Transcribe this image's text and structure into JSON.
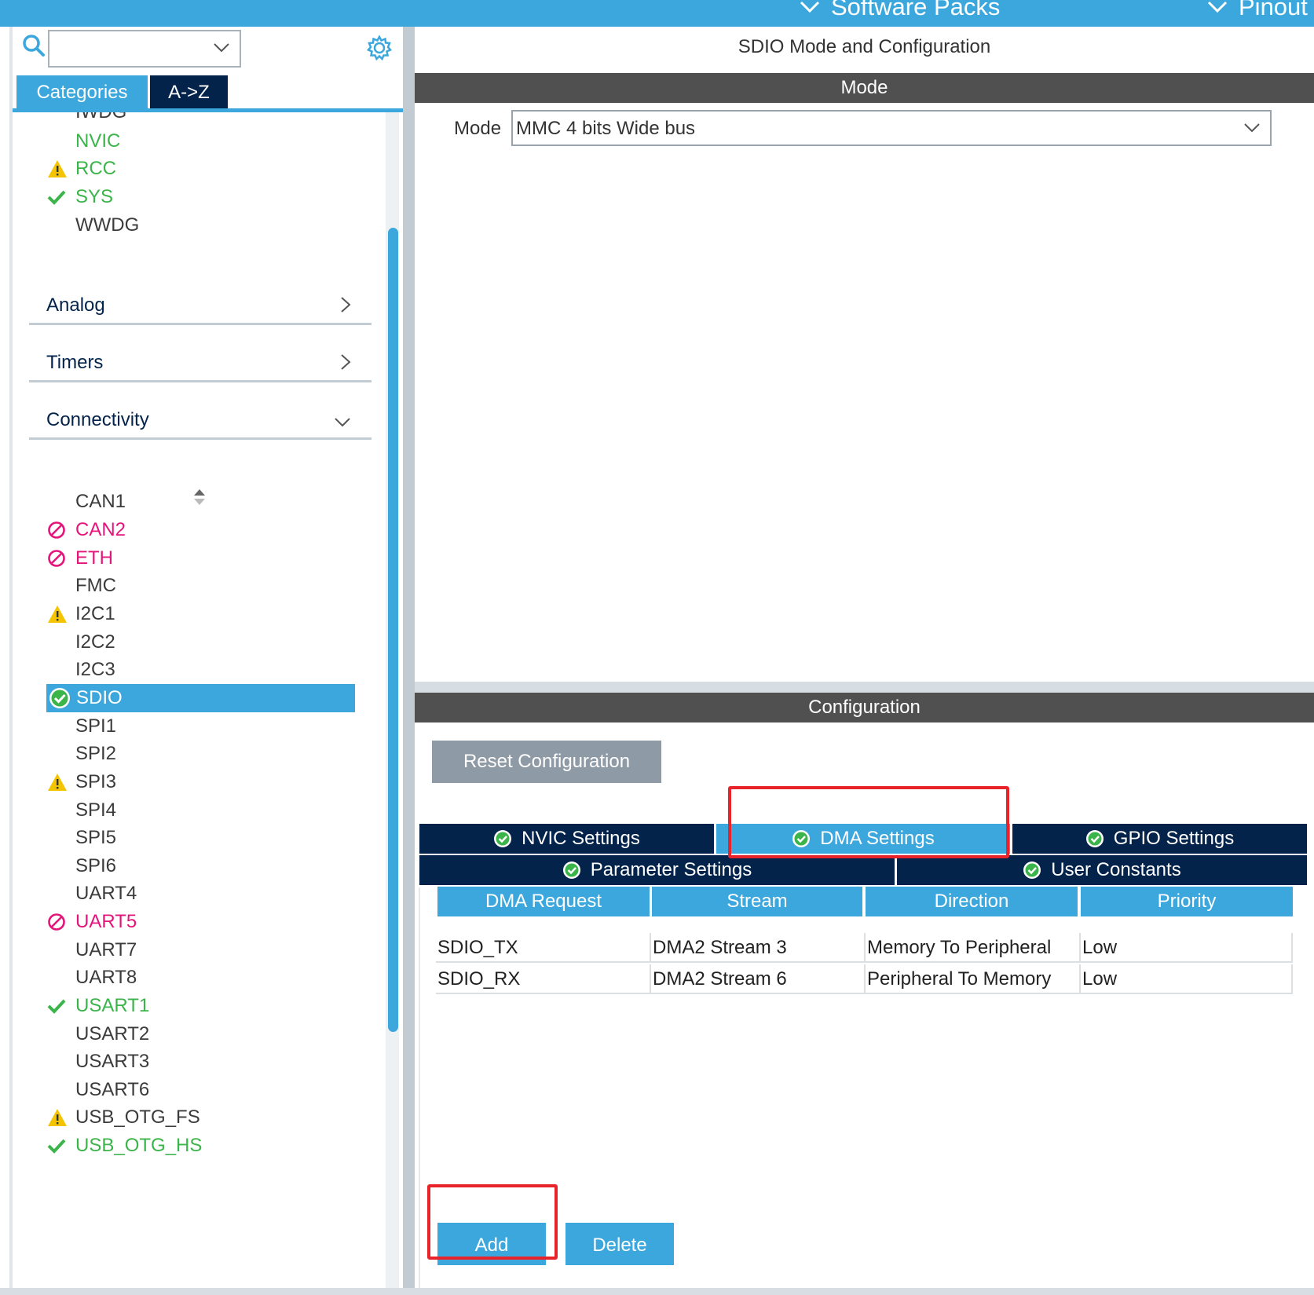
{
  "topbar": {
    "items": [
      "Software Packs",
      "Pinout"
    ]
  },
  "left": {
    "search_value": "",
    "tabs": [
      "Categories",
      "A->Z"
    ],
    "partial_item": "IWDG",
    "system_items": [
      {
        "label": "NVIC",
        "status": "none",
        "color": "green"
      },
      {
        "label": "RCC",
        "status": "warning",
        "color": "green"
      },
      {
        "label": "SYS",
        "status": "ok",
        "color": "green"
      },
      {
        "label": "WWDG",
        "status": "none",
        "color": "normal"
      }
    ],
    "categories": [
      "Analog",
      "Timers",
      "Connectivity"
    ],
    "connectivity_items": [
      {
        "label": "CAN1",
        "status": "none",
        "color": "normal"
      },
      {
        "label": "CAN2",
        "status": "disabled",
        "color": "pink"
      },
      {
        "label": "ETH",
        "status": "disabled",
        "color": "pink"
      },
      {
        "label": "FMC",
        "status": "none",
        "color": "normal"
      },
      {
        "label": "I2C1",
        "status": "warning",
        "color": "normal"
      },
      {
        "label": "I2C2",
        "status": "none",
        "color": "normal"
      },
      {
        "label": "I2C3",
        "status": "none",
        "color": "normal"
      },
      {
        "label": "SDIO",
        "status": "ok-selected",
        "color": "white"
      },
      {
        "label": "SPI1",
        "status": "none",
        "color": "normal"
      },
      {
        "label": "SPI2",
        "status": "none",
        "color": "normal"
      },
      {
        "label": "SPI3",
        "status": "warning",
        "color": "normal"
      },
      {
        "label": "SPI4",
        "status": "none",
        "color": "normal"
      },
      {
        "label": "SPI5",
        "status": "none",
        "color": "normal"
      },
      {
        "label": "SPI6",
        "status": "none",
        "color": "normal"
      },
      {
        "label": "UART4",
        "status": "none",
        "color": "normal"
      },
      {
        "label": "UART5",
        "status": "disabled",
        "color": "pink"
      },
      {
        "label": "UART7",
        "status": "none",
        "color": "normal"
      },
      {
        "label": "UART8",
        "status": "none",
        "color": "normal"
      },
      {
        "label": "USART1",
        "status": "ok",
        "color": "green"
      },
      {
        "label": "USART2",
        "status": "none",
        "color": "normal"
      },
      {
        "label": "USART3",
        "status": "none",
        "color": "normal"
      },
      {
        "label": "USART6",
        "status": "none",
        "color": "normal"
      },
      {
        "label": "USB_OTG_FS",
        "status": "warning",
        "color": "normal"
      },
      {
        "label": "USB_OTG_HS",
        "status": "ok",
        "color": "green"
      }
    ]
  },
  "right": {
    "title": "SDIO Mode and Configuration",
    "mode_band": "Mode",
    "mode_label": "Mode",
    "mode_value": "MMC 4 bits Wide bus",
    "config_band": "Configuration",
    "reset_button": "Reset Configuration",
    "tabs_row1": [
      "NVIC Settings",
      "DMA Settings",
      "GPIO Settings"
    ],
    "tabs_row2": [
      "Parameter Settings",
      "User Constants"
    ],
    "active_tab": "DMA Settings",
    "dma_table": {
      "headers": [
        "DMA Request",
        "Stream",
        "Direction",
        "Priority"
      ],
      "rows": [
        [
          "SDIO_TX",
          "DMA2 Stream 3",
          "Memory To Peripheral",
          "Low"
        ],
        [
          "SDIO_RX",
          "DMA2 Stream 6",
          "Peripheral To Memory",
          "Low"
        ]
      ]
    },
    "add_button": "Add",
    "delete_button": "Delete"
  },
  "colors": {
    "accent": "#3ca7dc",
    "navy": "#03234b",
    "band": "#505050",
    "ok_green": "#3bb44a",
    "error_pink": "#e4147b",
    "warning_yellow": "#f5c400",
    "highlight_red": "#e8232a"
  }
}
